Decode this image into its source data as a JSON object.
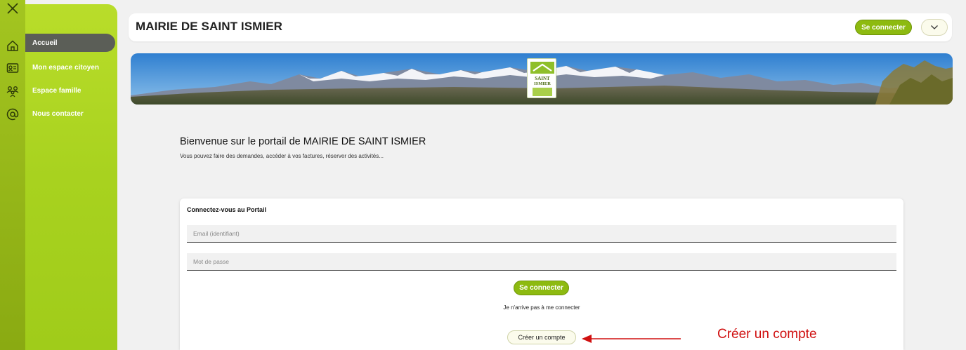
{
  "sidebar": {
    "items": [
      {
        "label": "Accueil",
        "icon": "home-icon",
        "active": true
      },
      {
        "label": "Mon espace citoyen",
        "icon": "id-card-icon",
        "active": false
      },
      {
        "label": "Espace famille",
        "icon": "family-icon",
        "active": false
      },
      {
        "label": "Nous contacter",
        "icon": "at-sign-icon",
        "active": false
      }
    ]
  },
  "header": {
    "title": "MAIRIE DE SAINT ISMIER",
    "login_label": "Se connecter"
  },
  "banner": {
    "logo_text_line1": "SAINT",
    "logo_text_line2": "ISMIER"
  },
  "welcome": {
    "title": "Bienvenue sur le portail de MAIRIE DE SAINT ISMIER",
    "subtitle": "Vous pouvez faire des demandes, accéder à vos factures, réserver des activités..."
  },
  "login_card": {
    "title": "Connectez-vous au Portail",
    "email_placeholder": "Email (identifiant)",
    "password_placeholder": "Mot de passe",
    "login_button": "Se connecter",
    "forgot_link": "Je n'arrive pas à me connecter",
    "create_account_button": "Créer un compte"
  },
  "annotation": {
    "text": "Créer un compte"
  },
  "colors": {
    "accent_green": "#8dba10",
    "sidebar_green": "#a8d21f",
    "active_item": "#5b5e57",
    "annotation_red": "#d01010"
  }
}
